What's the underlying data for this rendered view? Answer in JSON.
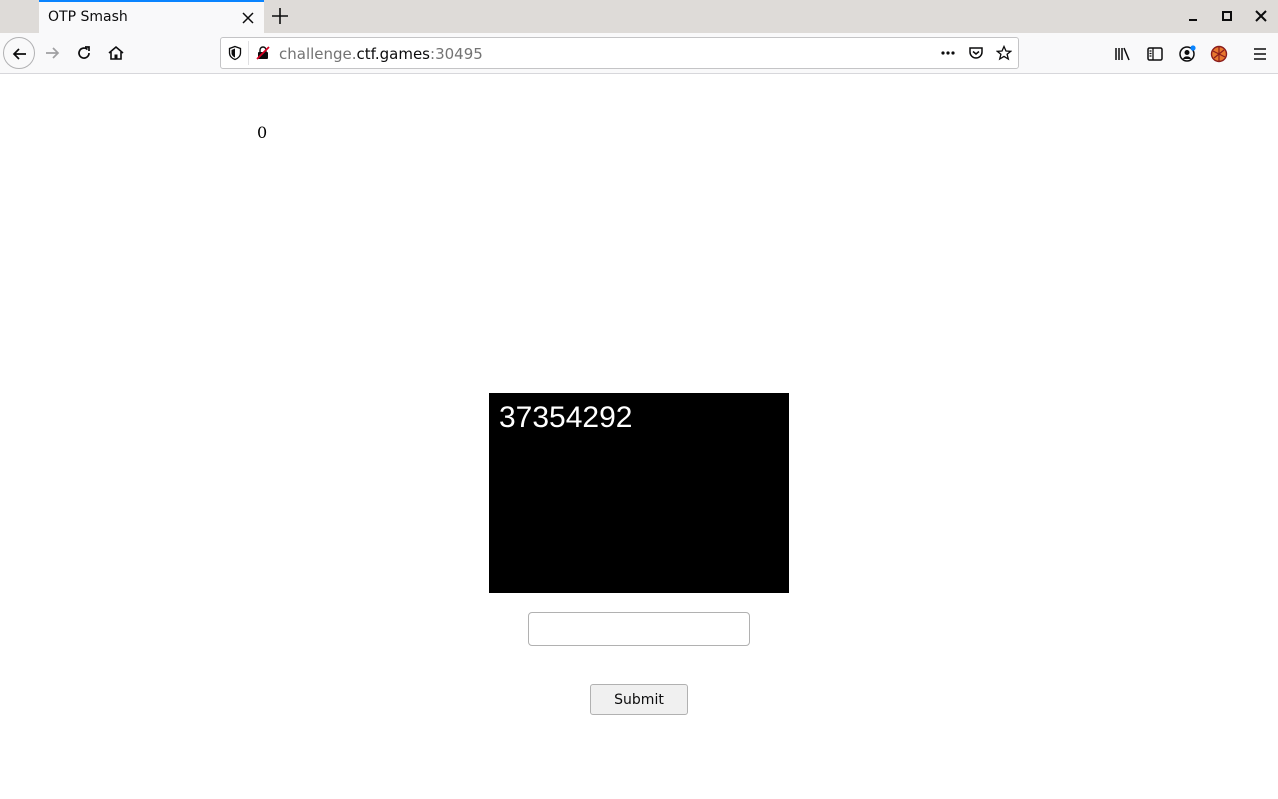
{
  "browser": {
    "tab": {
      "title": "OTP Smash"
    },
    "url": {
      "prefix": "challenge.",
      "host": "ctf.games",
      "suffix": ":30495"
    }
  },
  "page": {
    "counter": "0",
    "otp_code": "37354292",
    "input": {
      "value": "",
      "placeholder": ""
    },
    "submit_label": "Submit"
  },
  "colors": {
    "tab_accent": "#0a84ff",
    "otp_background": "#000000",
    "otp_text": "#ffffff"
  }
}
